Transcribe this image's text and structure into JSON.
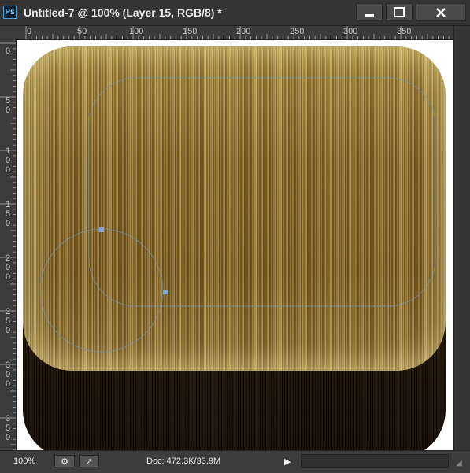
{
  "app": {
    "logo": "Ps"
  },
  "titlebar": {
    "title": "Untitled-7 @ 100% (Layer 15, RGB/8) *",
    "minimize_icon": "minimize-icon",
    "maximize_icon": "maximize-icon",
    "close_icon": "close-icon"
  },
  "ruler_h": {
    "labels": [
      "0",
      "50",
      "100",
      "150",
      "200",
      "250",
      "300",
      "350"
    ]
  },
  "ruler_v": {
    "labels": [
      "0",
      "50",
      "100",
      "150",
      "200",
      "250",
      "300",
      "350"
    ]
  },
  "statusbar": {
    "zoom": "100%",
    "doc_info": "Doc: 472.3K/33.9M",
    "arrow": "▶"
  },
  "colors": {
    "wood_light": "#b69a4c",
    "wood_dark": "#241506",
    "path_stroke": "#7f8fa0",
    "anchor": "#7aa7d8"
  }
}
